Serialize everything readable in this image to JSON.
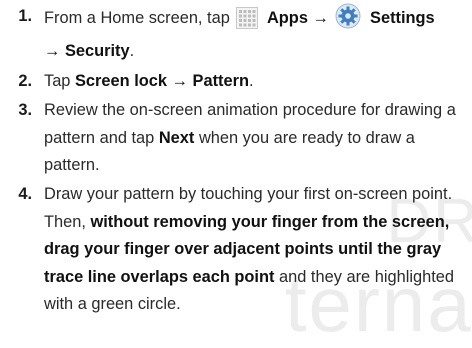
{
  "steps": [
    {
      "number": "1.",
      "parts": {
        "t1": "From a Home screen, tap",
        "apps": "Apps",
        "arrow1": "→",
        "settings": "Settings",
        "arrow2": "→",
        "security": "Security",
        "t2": "."
      },
      "icons": [
        "apps-grid-icon",
        "settings-gear-icon"
      ]
    },
    {
      "number": "2.",
      "parts": {
        "t1": "Tap",
        "screen_lock": "Screen lock",
        "arrow": "→",
        "pattern": "Pattern",
        "t2": "."
      }
    },
    {
      "number": "3.",
      "parts": {
        "t1": "Review the on-screen animation procedure for drawing a pattern and tap",
        "next": "Next",
        "t2": "when you are ready to draw a pattern."
      }
    },
    {
      "number": "4.",
      "parts": {
        "t1": "Draw your pattern by touching your first on-screen point. Then,",
        "bold": "without removing your finger from the screen, drag your finger over adjacent points until the gray trace line overlaps each point",
        "t2": "and they are highlighted with a green circle."
      }
    }
  ],
  "watermark": {
    "line1": "DR",
    "line2": "ternal"
  },
  "colors": {
    "text": "#2a2a2a",
    "watermark": "#ececec",
    "gear_blue": "#3f7fbf"
  }
}
